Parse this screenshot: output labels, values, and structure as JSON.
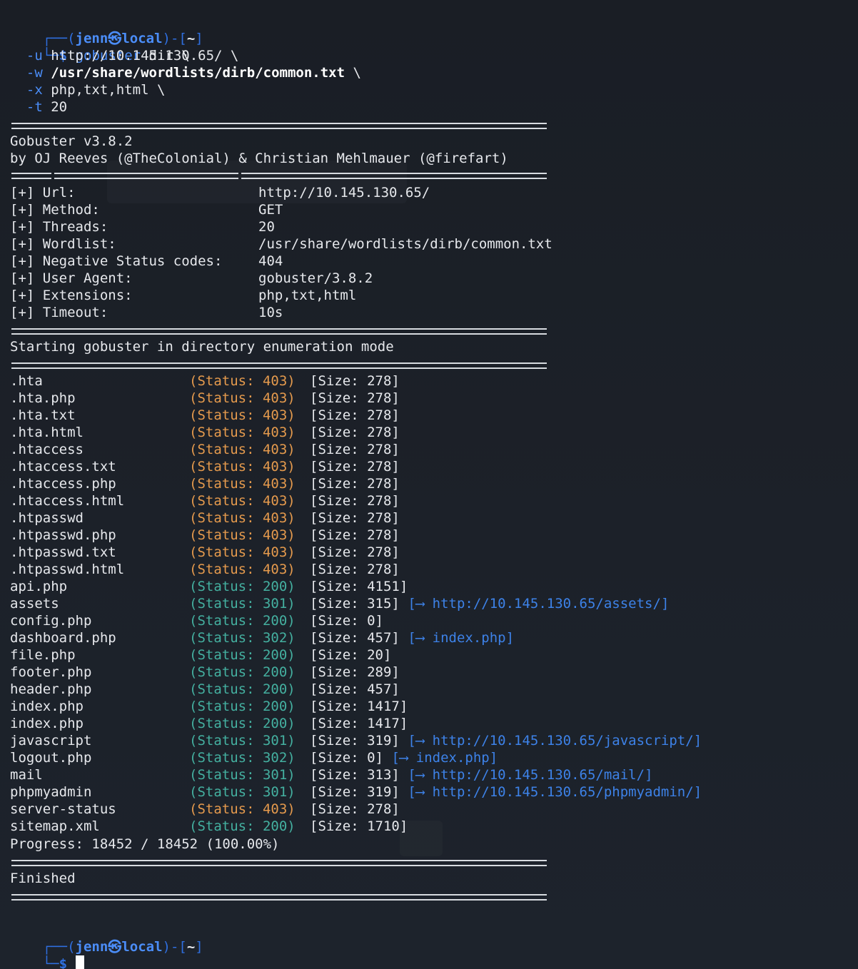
{
  "prompt": {
    "user": "jenn",
    "at_symbol": "㉿",
    "host": "local",
    "path": "~",
    "dollar": "$"
  },
  "command": {
    "name": "gobuster",
    "args": "dir \\",
    "lines": [
      {
        "flag": "-u",
        "value": "http://10.145.130.65/ \\",
        "bold": false
      },
      {
        "flag": "-w",
        "value": "/usr/share/wordlists/dirb/common.txt",
        "suffix": " \\",
        "bold": true
      },
      {
        "flag": "-x",
        "value": "php,txt,html \\",
        "bold": false
      },
      {
        "flag": "-t",
        "value": "20",
        "bold": false
      }
    ]
  },
  "banner": {
    "title": "Gobuster v3.8.2",
    "credits": "by OJ Reeves (@TheColonial) & Christian Mehlmauer (@firefart)"
  },
  "config": [
    {
      "label": "[+] Url:",
      "value": "http://10.145.130.65/"
    },
    {
      "label": "[+] Method:",
      "value": "GET"
    },
    {
      "label": "[+] Threads:",
      "value": "20"
    },
    {
      "label": "[+] Wordlist:",
      "value": "/usr/share/wordlists/dirb/common.txt"
    },
    {
      "label": "[+] Negative Status codes:",
      "value": "404"
    },
    {
      "label": "[+] User Agent:",
      "value": "gobuster/3.8.2"
    },
    {
      "label": "[+] Extensions:",
      "value": "php,txt,html"
    },
    {
      "label": "[+] Timeout:",
      "value": "10s"
    }
  ],
  "start_message": "Starting gobuster in directory enumeration mode",
  "results": [
    {
      "path": ".hta",
      "status": "403",
      "size": "278",
      "redirect": ""
    },
    {
      "path": ".hta.php",
      "status": "403",
      "size": "278",
      "redirect": ""
    },
    {
      "path": ".hta.txt",
      "status": "403",
      "size": "278",
      "redirect": ""
    },
    {
      "path": ".hta.html",
      "status": "403",
      "size": "278",
      "redirect": ""
    },
    {
      "path": ".htaccess",
      "status": "403",
      "size": "278",
      "redirect": ""
    },
    {
      "path": ".htaccess.txt",
      "status": "403",
      "size": "278",
      "redirect": ""
    },
    {
      "path": ".htaccess.php",
      "status": "403",
      "size": "278",
      "redirect": ""
    },
    {
      "path": ".htaccess.html",
      "status": "403",
      "size": "278",
      "redirect": ""
    },
    {
      "path": ".htpasswd",
      "status": "403",
      "size": "278",
      "redirect": ""
    },
    {
      "path": ".htpasswd.php",
      "status": "403",
      "size": "278",
      "redirect": ""
    },
    {
      "path": ".htpasswd.txt",
      "status": "403",
      "size": "278",
      "redirect": ""
    },
    {
      "path": ".htpasswd.html",
      "status": "403",
      "size": "278",
      "redirect": ""
    },
    {
      "path": "api.php",
      "status": "200",
      "size": "4151",
      "redirect": ""
    },
    {
      "path": "assets",
      "status": "301",
      "size": "315",
      "redirect": "http://10.145.130.65/assets/"
    },
    {
      "path": "config.php",
      "status": "200",
      "size": "0",
      "redirect": ""
    },
    {
      "path": "dashboard.php",
      "status": "302",
      "size": "457",
      "redirect": "index.php"
    },
    {
      "path": "file.php",
      "status": "200",
      "size": "20",
      "redirect": ""
    },
    {
      "path": "footer.php",
      "status": "200",
      "size": "289",
      "redirect": ""
    },
    {
      "path": "header.php",
      "status": "200",
      "size": "457",
      "redirect": ""
    },
    {
      "path": "index.php",
      "status": "200",
      "size": "1417",
      "redirect": ""
    },
    {
      "path": "index.php",
      "status": "200",
      "size": "1417",
      "redirect": ""
    },
    {
      "path": "javascript",
      "status": "301",
      "size": "319",
      "redirect": "http://10.145.130.65/javascript/"
    },
    {
      "path": "logout.php",
      "status": "302",
      "size": "0",
      "redirect": "index.php"
    },
    {
      "path": "mail",
      "status": "301",
      "size": "313",
      "redirect": "http://10.145.130.65/mail/"
    },
    {
      "path": "phpmyadmin",
      "status": "301",
      "size": "319",
      "redirect": "http://10.145.130.65/phpmyadmin/"
    },
    {
      "path": "server-status",
      "status": "403",
      "size": "278",
      "redirect": ""
    },
    {
      "path": "sitemap.xml",
      "status": "200",
      "size": "1710",
      "redirect": ""
    }
  ],
  "progress": {
    "text": "Progress: 18452 / 18452 (100.00%)",
    "done": 18452,
    "total": 18452
  },
  "finished_message": "Finished",
  "colors": {
    "prompt": "#4b8df8",
    "status_403": "#e59a4d",
    "status_ok": "#44b0a0",
    "redirect": "#3d82e8",
    "background": "#1c2129"
  }
}
